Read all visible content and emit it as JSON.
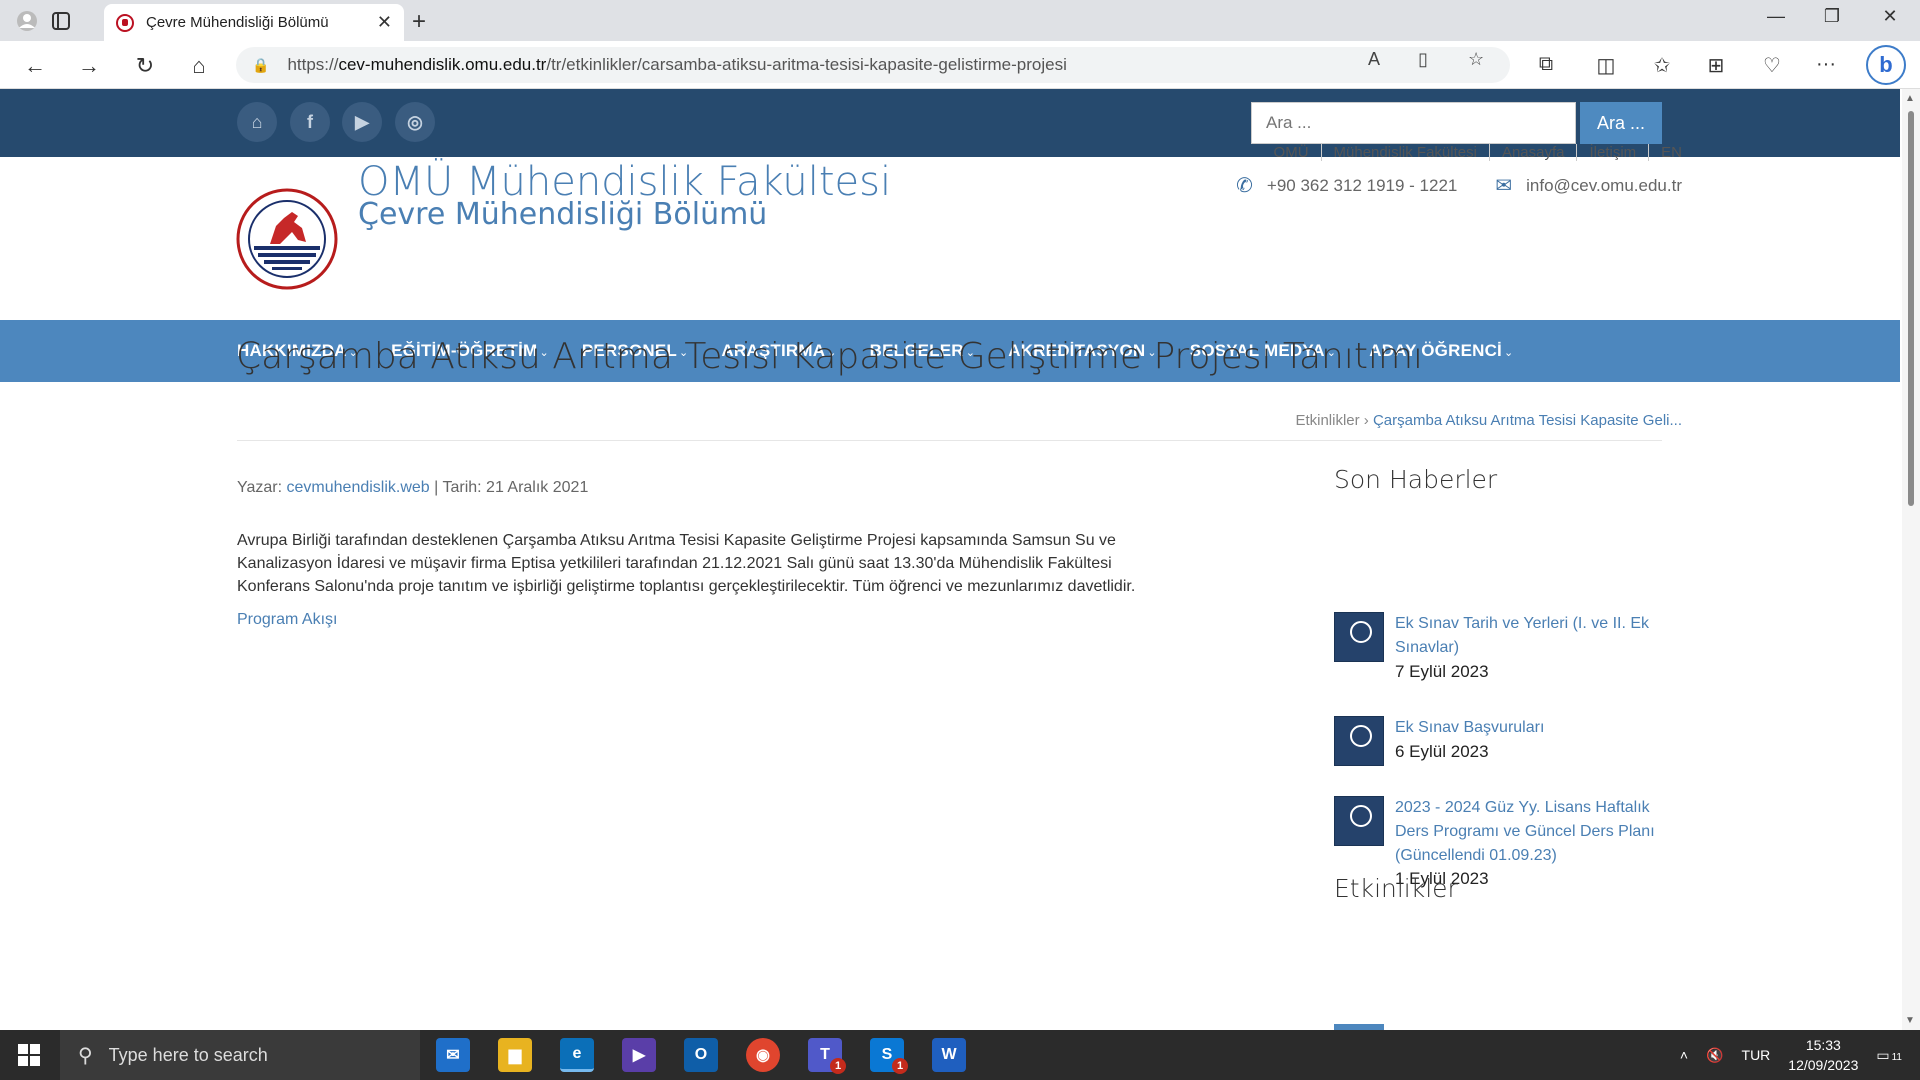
{
  "browser": {
    "tab_title": "Çevre Mühendisliği Bölümü",
    "url_prefix": "https://",
    "url_domain": "cev-muhendislik.omu.edu.tr",
    "url_path": "/tr/etkinlikler/carsamba-atiksu-aritma-tesisi-kapasite-gelistirme-projesi"
  },
  "site": {
    "search_placeholder": "Ara ...",
    "search_button": "Ara ...",
    "faculty_title": "OMÜ Mühendislik Fakültesi",
    "department_title": "Çevre Mühendisliği Bölümü",
    "top_links": [
      "OMÜ",
      "Mühendislik Fakültesi",
      "Anasayfa",
      "İletişim",
      "EN"
    ],
    "phone": "+90 362 312 1919 - 1221",
    "email": "info@cev.omu.edu.tr",
    "nav": [
      "HAKKIMIZDA",
      "EĞİTİM-ÖĞRETİM",
      "PERSONEL",
      "ARAŞTIRMA",
      "BELGELER",
      "AKREDİTASYON",
      "SOSYAL MEDYA",
      "ADAY ÖĞRENCİ"
    ]
  },
  "article": {
    "title": "Çarşamba Atıksu Arıtma Tesisi Kapasite Geliştirme Projesi Tanıtımı",
    "breadcrumb_parent": "Etkinlikler",
    "breadcrumb_current": "Çarşamba Atıksu Arıtma Tesisi Kapasite Geli...",
    "author_label": "Yazar:",
    "author": "cevmuhendislik.web",
    "date_text": "| Tarih: 21 Aralık 2021",
    "body": "Avrupa Birliği tarafından desteklenen Çarşamba Atıksu Arıtma Tesisi Kapasite Geliştirme Projesi kapsamında Samsun Su ve Kanalizasyon İdaresi ve müşavir firma Eptisa yetkilileri tarafından 21.12.2021 Salı günü saat 13.30'da Mühendislik Fakültesi Konferans Salonu'nda proje tanıtım ve işbirliği geliştirme toplantısı gerçekleştirilecektir. Tüm öğrenci ve mezunlarımız davetlidir.",
    "program_link": "Program Akışı"
  },
  "sidebar": {
    "news_heading": "Son Haberler",
    "news": [
      {
        "title": "Ek Sınav Tarih ve Yerleri (I. ve II. Ek Sınavlar)",
        "date": "7 Eylül 2023"
      },
      {
        "title": "Ek Sınav Başvuruları",
        "date": "6 Eylül 2023"
      },
      {
        "title": "2023 - 2024 Güz Yy. Lisans Haftalık Ders Programı ve Güncel Ders Planı (Güncellendi 01.09.23)",
        "date": "1 Eylül 2023"
      }
    ],
    "events_heading": "Etkinlikler"
  },
  "taskbar": {
    "search_placeholder": "Type here to search",
    "language": "TUR",
    "time": "15:33",
    "date": "12/09/2023",
    "notification_count": "11"
  }
}
